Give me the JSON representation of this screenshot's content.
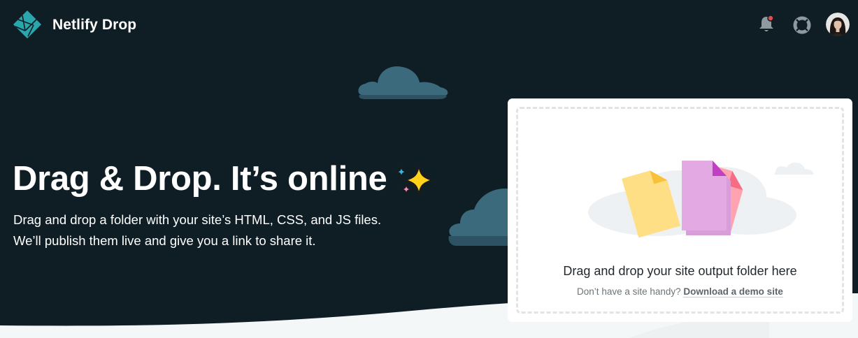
{
  "header": {
    "brand": "Netlify Drop",
    "logo_icon": "netlify-logo",
    "notification_icon": "bell-icon",
    "support_icon": "lifebuoy-icon",
    "avatar_icon": "user-avatar"
  },
  "hero": {
    "title": "Drag & Drop. It’s online",
    "emoji_icon": "sparkles-icon",
    "line1": "Drag and drop a folder with your site’s HTML, CSS, and JS files.",
    "line2": "We’ll publish them live and give you a link to share it."
  },
  "dropzone": {
    "title": "Drag and drop your site output folder here",
    "subtitle": "Don’t have a site handy?",
    "link": "Download a demo site"
  },
  "colors": {
    "background": "#0f1e25",
    "logo": "#1fa0a9",
    "cloud": "#3c6a7d",
    "notification_dot": "#e84a4a"
  }
}
